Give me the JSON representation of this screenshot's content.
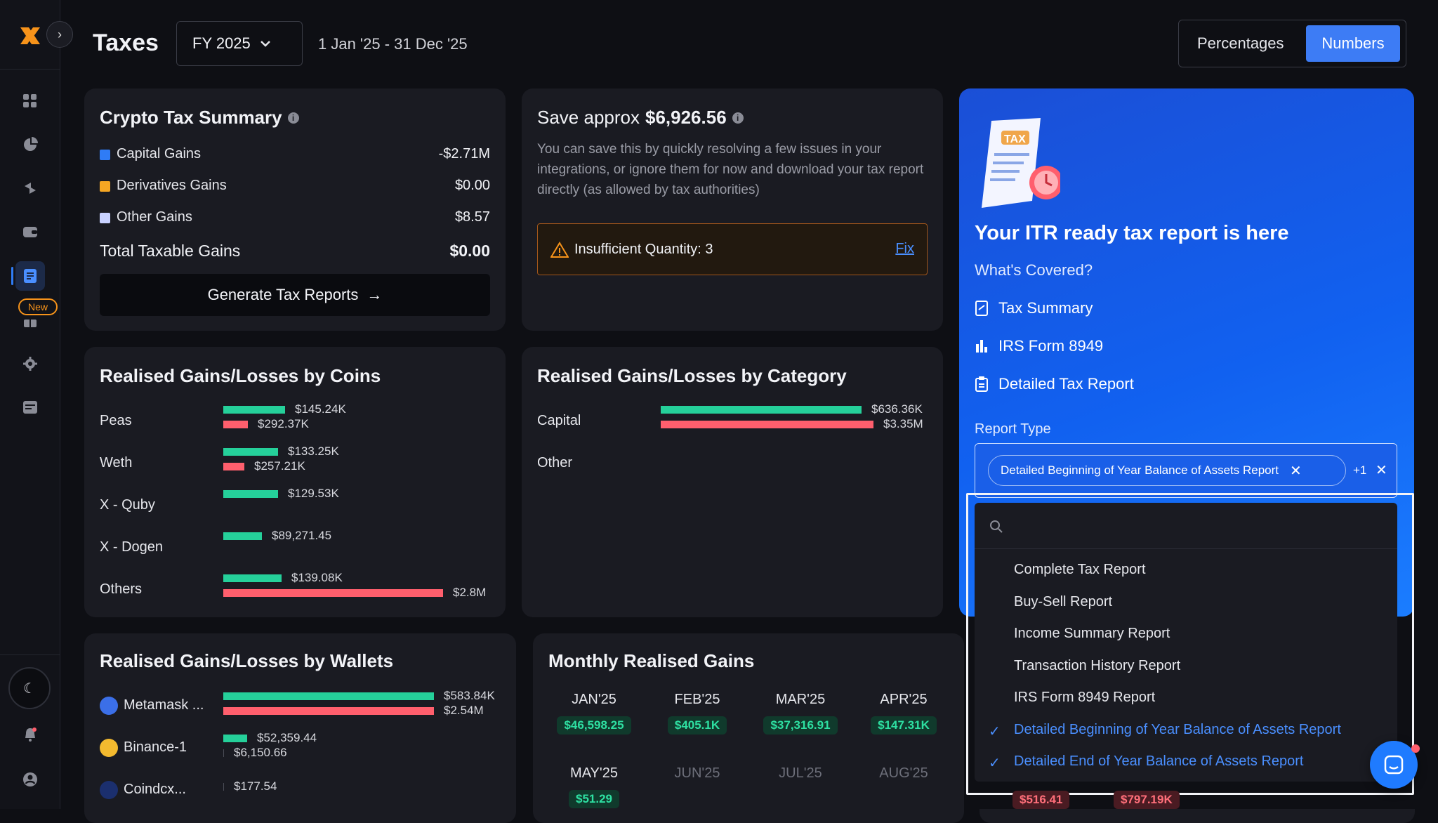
{
  "page": {
    "title": "Taxes",
    "fy": "FY 2025",
    "date_range": "1 Jan '25 - 31 Dec '25"
  },
  "toggle": {
    "percentages": "Percentages",
    "numbers": "Numbers"
  },
  "sidebar": {
    "new_badge": "New"
  },
  "summary": {
    "title": "Crypto Tax Summary",
    "rows": [
      {
        "label": "Capital Gains",
        "value": "-$2.71M",
        "color": "#2f7cf6"
      },
      {
        "label": "Derivatives Gains",
        "value": "$0.00",
        "color": "#f5a623"
      },
      {
        "label": "Other Gains",
        "value": "$8.57",
        "color": "#c9d2ff"
      }
    ],
    "total_label": "Total Taxable Gains",
    "total_value": "$0.00",
    "button": "Generate Tax Reports"
  },
  "save": {
    "prefix": "Save approx",
    "amount": "$6,926.56",
    "desc": "You can save this by quickly resolving a few issues in your integrations, or ignore them for now and download your tax report directly (as allowed by tax authorities)",
    "issue": "Insufficient Quantity: 3",
    "fix": "Fix"
  },
  "promo": {
    "tax_tag": "TAX",
    "title": "Your ITR ready tax report is here",
    "covered": "What's Covered?",
    "items": [
      "Tax Summary",
      "IRS Form 8949",
      "Detailed Tax Report"
    ],
    "report_type": "Report Type",
    "chip": "Detailed Beginning of Year Balance of Assets Report",
    "more": "+1"
  },
  "dropdown": {
    "options": [
      {
        "label": "Complete Tax Report",
        "selected": false
      },
      {
        "label": "Buy-Sell Report",
        "selected": false
      },
      {
        "label": "Income Summary Report",
        "selected": false
      },
      {
        "label": "Transaction History Report",
        "selected": false
      },
      {
        "label": "IRS Form 8949 Report",
        "selected": false
      },
      {
        "label": "Detailed Beginning of Year Balance of Assets Report",
        "selected": true
      },
      {
        "label": "Detailed End of Year Balance of Assets Report",
        "selected": true
      }
    ]
  },
  "coins": {
    "title": "Realised Gains/Losses by Coins",
    "rows": [
      {
        "label": "Peas",
        "gain": "$145.24K",
        "loss": "$292.37K"
      },
      {
        "label": "Weth",
        "gain": "$133.25K",
        "loss": "$257.21K"
      },
      {
        "label": "X - Quby",
        "gain": "$129.53K",
        "loss": ""
      },
      {
        "label": "X - Dogen",
        "gain": "$89,271.45",
        "loss": ""
      },
      {
        "label": "Others",
        "gain": "$139.08K",
        "loss": "$2.8M"
      }
    ]
  },
  "category": {
    "title": "Realised Gains/Losses by Category",
    "rows": [
      {
        "label": "Capital",
        "gain": "$636.36K",
        "loss": "$3.35M"
      },
      {
        "label": "Other",
        "gain": "",
        "loss": ""
      }
    ]
  },
  "wallets": {
    "title": "Realised Gains/Losses by Wallets",
    "rows": [
      {
        "label": "Metamask ...",
        "gain": "$583.84K",
        "loss": "$2.54M"
      },
      {
        "label": "Binance-1",
        "gain": "$52,359.44",
        "loss": "$6,150.66"
      },
      {
        "label": "Coindcx...",
        "gain": "",
        "loss": "$177.54"
      }
    ]
  },
  "monthly": {
    "title": "Monthly Realised Gains",
    "months": [
      {
        "m": "JAN'25",
        "v": "$46,598.25",
        "t": "g"
      },
      {
        "m": "FEB'25",
        "v": "$405.1K",
        "t": "g"
      },
      {
        "m": "MAR'25",
        "v": "$37,316.91",
        "t": "g"
      },
      {
        "m": "APR'25",
        "v": "$147.31K",
        "t": "g"
      },
      {
        "m": "MAY'25",
        "v": "$51.29",
        "t": "g"
      },
      {
        "m": "JUN'25",
        "v": "",
        "t": ""
      },
      {
        "m": "JUL'25",
        "v": "",
        "t": ""
      },
      {
        "m": "AUG'25",
        "v": "",
        "t": ""
      }
    ],
    "behind": [
      "$516.41",
      "$797.19K"
    ]
  }
}
